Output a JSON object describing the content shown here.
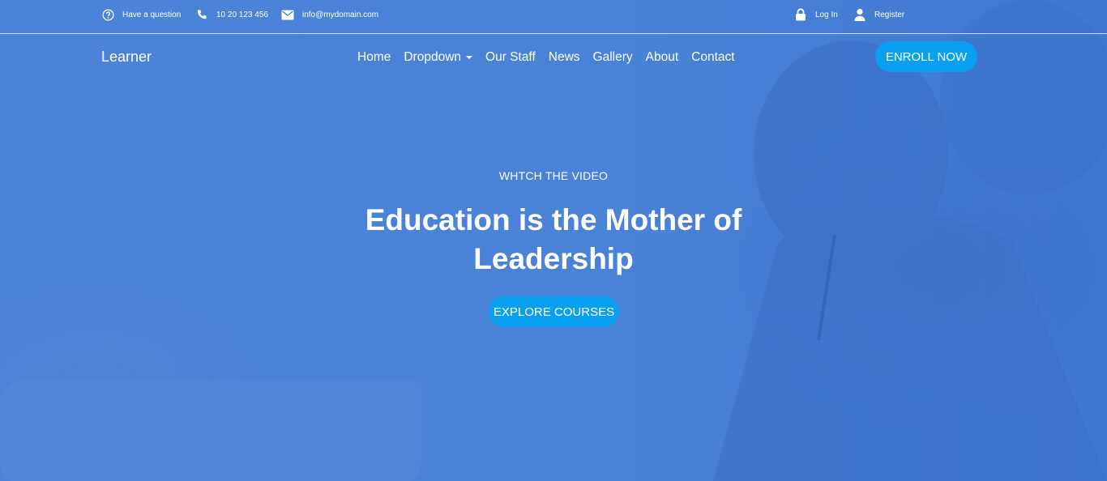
{
  "topbar": {
    "question": {
      "icon": "question-circle-icon",
      "label": "Have a question"
    },
    "phone": {
      "icon": "phone-icon",
      "label": "10 20 123 456"
    },
    "email": {
      "icon": "envelope-icon",
      "label": "info@mydomain.com"
    },
    "login": {
      "icon": "lock-icon",
      "label": "Log In"
    },
    "register": {
      "icon": "user-icon",
      "label": "Register"
    }
  },
  "navbar": {
    "brand": "Learner",
    "items": [
      {
        "label": "Home"
      },
      {
        "label": "Dropdown",
        "has_caret": true
      },
      {
        "label": "Our Staff"
      },
      {
        "label": "News"
      },
      {
        "label": "Gallery"
      },
      {
        "label": "About"
      },
      {
        "label": "Contact"
      }
    ],
    "cta": "ENROLL NOW"
  },
  "hero": {
    "kicker": "WHTCH THE VIDEO",
    "headline": "Education is the Mother of Leadership",
    "cta": "EXPLORE COURSES"
  },
  "colors": {
    "overlay_blue": "#4a82d6",
    "button_blue": "#0aa0f2",
    "text": "#ffffff"
  }
}
